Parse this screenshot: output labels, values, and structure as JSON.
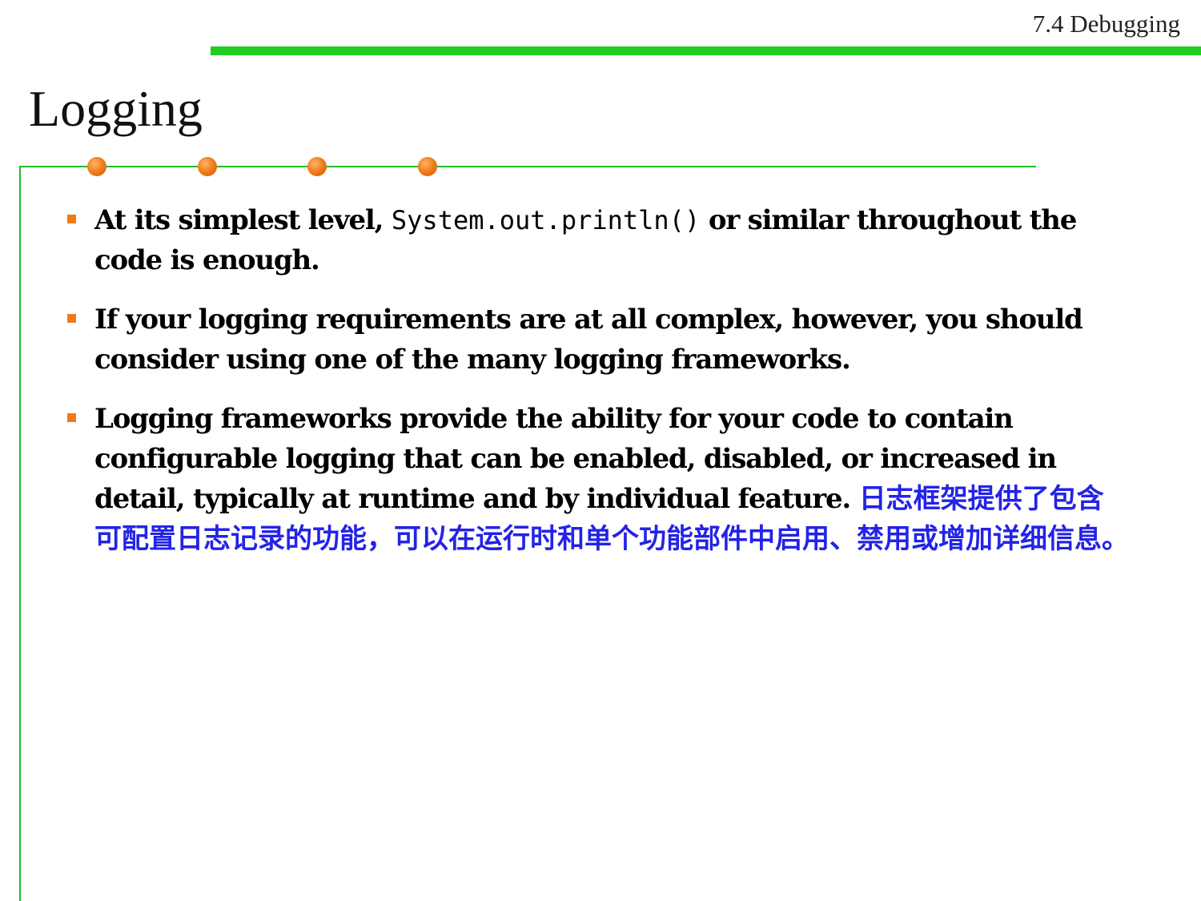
{
  "header": {
    "section_label": "7.4 Debugging",
    "title": "Logging"
  },
  "colors": {
    "accent_green": "#22cc22",
    "bullet_orange": "#f07a1a",
    "translation_blue": "#2323e8"
  },
  "bullets": [
    {
      "text_before": "At its simplest level, ",
      "code": "System.out.println()",
      "text_after": " or similar throughout the code is enough."
    },
    {
      "text": "If your logging requirements are at all complex, however, you should consider using one of the many logging frameworks."
    },
    {
      "text": "Logging frameworks provide the ability for your code to contain configurable logging that can be enabled, disabled, or increased in detail, typically at runtime and by individual feature. ",
      "translation": "日志框架提供了包含可配置日志记录的功能，可以在运行时和单个功能部件中启用、禁用或增加详细信息。"
    }
  ]
}
